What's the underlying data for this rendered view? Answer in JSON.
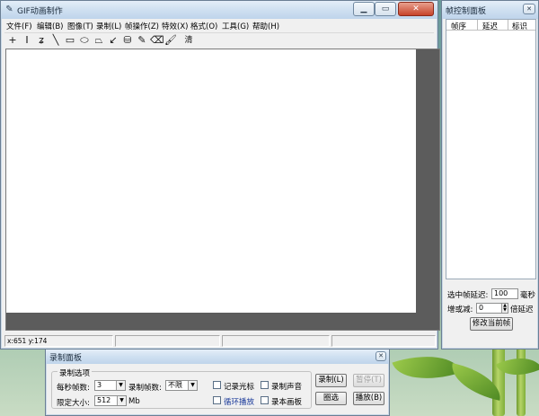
{
  "main_window": {
    "title": "GIF动画制作",
    "menu": [
      "文件(F)",
      "编辑(B)",
      "图像(T)",
      "录制(L)",
      "帧操作(Z)",
      "特效(X)",
      "格式(O)",
      "工具(G)",
      "帮助(H)"
    ],
    "tools": [
      {
        "icon": "crosshair-icon",
        "glyph": "+"
      },
      {
        "icon": "text-cursor-icon",
        "glyph": "I"
      },
      {
        "icon": "curve-icon",
        "glyph": "ʑ"
      },
      {
        "icon": "line-icon",
        "glyph": "╲"
      },
      {
        "icon": "rectangle-icon",
        "glyph": "▭"
      },
      {
        "icon": "ellipse-icon",
        "glyph": "⬭"
      },
      {
        "icon": "polygon-icon",
        "glyph": "⏢"
      },
      {
        "icon": "arrow-icon",
        "glyph": "↙"
      },
      {
        "icon": "fill-bucket-icon",
        "glyph": "⛁"
      },
      {
        "icon": "eyedropper-icon",
        "glyph": "✎"
      },
      {
        "icon": "eraser-icon",
        "glyph": "⌫"
      },
      {
        "icon": "brush-icon",
        "glyph": "🖌"
      }
    ],
    "clear_label": "清",
    "status_coords": "x:651 y:174"
  },
  "frame_panel": {
    "title": "帧控制面板",
    "columns": [
      "帧序",
      "延迟",
      "标识"
    ],
    "delay_label": "选中帧延迟:",
    "delay_value": "100",
    "delay_unit": "毫秒",
    "adjust_label": "增或减:",
    "adjust_value": "0",
    "adjust_unit": "倍延迟",
    "modify_button": "修改当前帧"
  },
  "record_panel": {
    "title": "录制面板",
    "group_label": "录制选项",
    "fps_label": "每秒帧数:",
    "fps_value": "3",
    "frames_label": "录制帧数:",
    "frames_value": "不限",
    "limit_label": "限定大小:",
    "limit_value": "512",
    "limit_unit": "Mb",
    "cb_cursor": "记录光标",
    "cb_sound": "录制声音",
    "cb_loop": "循环播放",
    "cb_local": "录本画板",
    "btn_record": "录制(L)",
    "btn_pause": "暂停(T)",
    "btn_select": "圈选",
    "btn_play": "播放(B)"
  }
}
